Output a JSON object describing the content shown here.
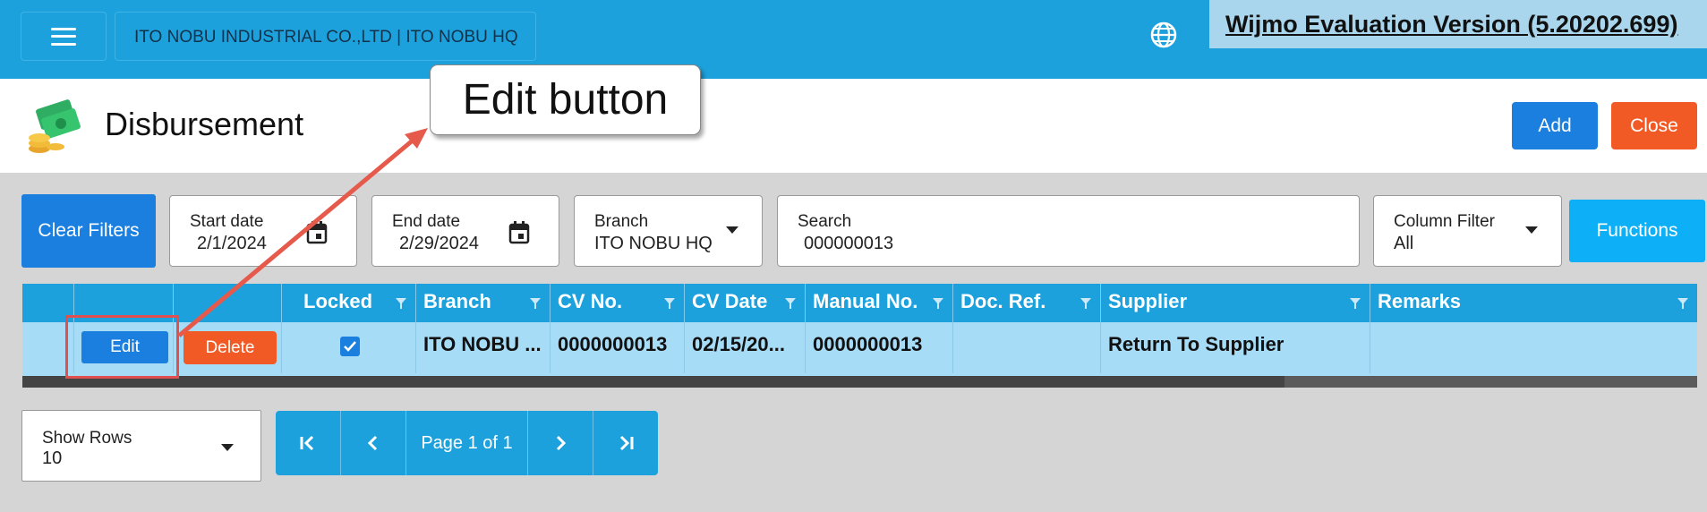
{
  "topbar": {
    "company": "ITO NOBU INDUSTRIAL CO.,LTD | ITO NOBU HQ",
    "watermark": "Wijmo Evaluation Version (5.20202.699)",
    "accent": "#1da1dc"
  },
  "header": {
    "title": "Disbursement",
    "add_label": "Add",
    "close_label": "Close"
  },
  "callout": "Edit button",
  "filters": {
    "clear_label": "Clear Filters",
    "start_date": {
      "label": "Start date",
      "value": "2/1/2024"
    },
    "end_date": {
      "label": "End date",
      "value": "2/29/2024"
    },
    "branch": {
      "label": "Branch",
      "value": "ITO NOBU HQ"
    },
    "search": {
      "label": "Search",
      "value": "000000013"
    },
    "column_filter": {
      "label": "Column Filter",
      "value": "All"
    },
    "functions_label": "Functions"
  },
  "grid": {
    "columns": [
      "Locked",
      "Branch",
      "CV No.",
      "CV Date",
      "Manual No.",
      "Doc. Ref.",
      "Supplier",
      "Remarks"
    ],
    "rows": [
      {
        "edit_label": "Edit",
        "delete_label": "Delete",
        "locked": true,
        "branch": "ITO NOBU ...",
        "cv_no": "0000000013",
        "cv_date": "02/15/20...",
        "manual_no": "0000000013",
        "doc_ref": "",
        "supplier": "Return To Supplier",
        "remarks": ""
      }
    ]
  },
  "pager": {
    "show_rows_label": "Show Rows",
    "show_rows_value": "10",
    "page_text": "Page 1 of 1"
  },
  "icons": [
    "menu-icon",
    "globe-icon",
    "disbursement-icon",
    "calendar-icon",
    "chevron-down-icon",
    "filter-icon",
    "check-icon",
    "first-page-icon",
    "previous-page-icon",
    "next-page-icon",
    "last-page-icon"
  ]
}
